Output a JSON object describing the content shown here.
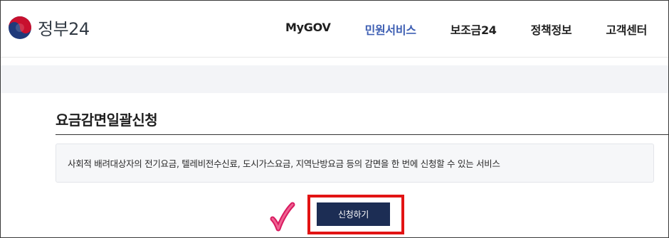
{
  "header": {
    "logo_text": "정부24",
    "logo_icon": "taegeuk-emblem-icon",
    "nav": [
      {
        "label": "MyGOV",
        "active": false
      },
      {
        "label": "민원서비스",
        "active": true
      },
      {
        "label": "보조금24",
        "active": false
      },
      {
        "label": "정책정보",
        "active": false
      },
      {
        "label": "고객센터",
        "active": false
      }
    ],
    "active_color": "#3e5fb3"
  },
  "main": {
    "title": "요금감면일괄신청",
    "description": "사회적 배려대상자의 전기요금, 텔레비전수신료, 도시가스요금, 지역난방요금 등의 감면을 한 번에 신청할 수 있는 서비스",
    "apply_button": "신청하기",
    "button_color": "#1c2d54"
  },
  "annotations": {
    "highlight_color": "#e21313",
    "checkmark_icon": "checkmark-icon",
    "checkmark_color": "#d81b60"
  }
}
